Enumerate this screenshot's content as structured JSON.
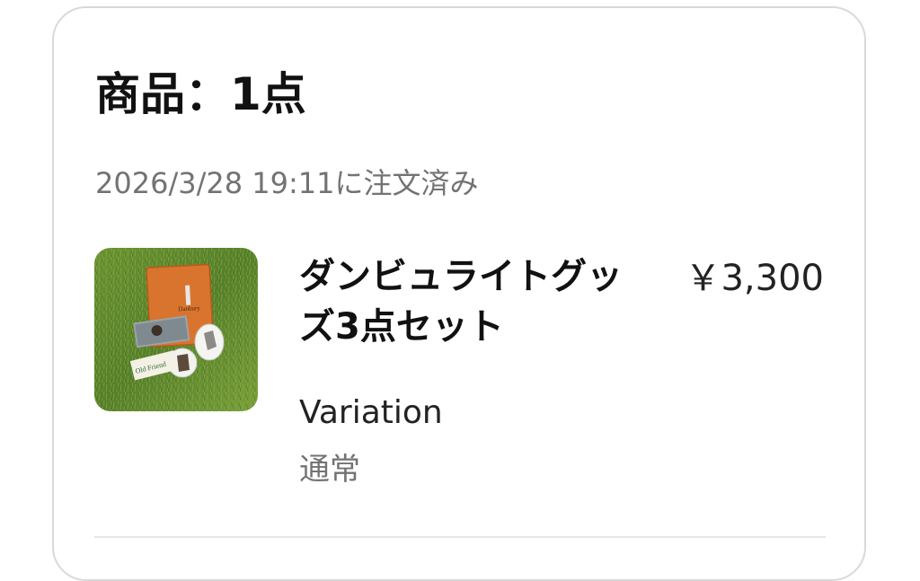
{
  "order": {
    "title": "商品：1点",
    "ordered_at": "2026/3/28 19:11に注文済み"
  },
  "item": {
    "name": "ダンビュライトグッズ3点セット",
    "price": "￥3,300",
    "variation_label": "Variation",
    "variation_value": "通常",
    "image_texts": {
      "sticker_brand": "Old Friend",
      "pouch_logo": "Danbury"
    }
  },
  "colors": {
    "card_border": "#d9d9d9",
    "secondary_text": "#737373",
    "pouch": "#d9742e",
    "grass": "#5f8a2f"
  }
}
